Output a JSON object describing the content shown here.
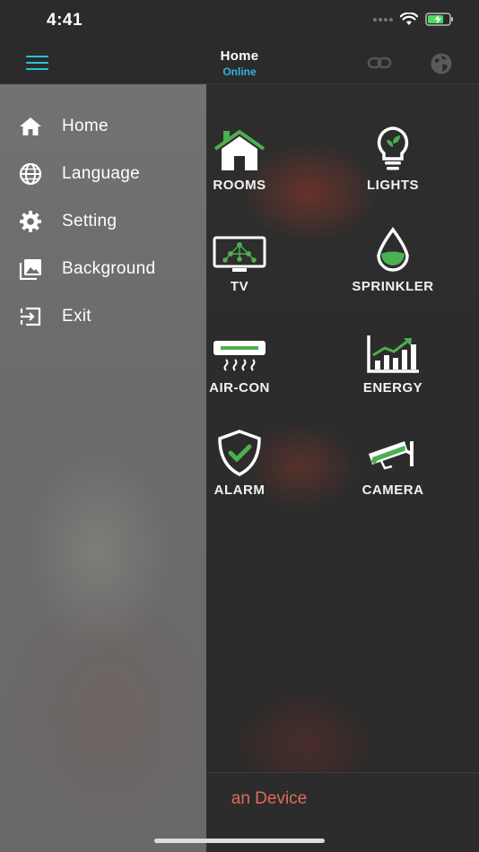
{
  "status_bar": {
    "time": "4:41"
  },
  "header": {
    "title": "Home",
    "subtitle": "Online"
  },
  "grid": [
    {
      "label": "ROOMS",
      "icon": "house-icon"
    },
    {
      "label": "LIGHTS",
      "icon": "lightbulb-icon"
    },
    {
      "label": "TV",
      "icon": "tv-icon"
    },
    {
      "label": "SPRINKLER",
      "icon": "water-drop-icon"
    },
    {
      "label": "AIR-CON",
      "icon": "air-conditioner-icon"
    },
    {
      "label": "ENERGY",
      "icon": "energy-chart-icon"
    },
    {
      "label": "ALARM",
      "icon": "shield-check-icon"
    },
    {
      "label": "CAMERA",
      "icon": "security-camera-icon"
    }
  ],
  "drawer": {
    "items": [
      {
        "label": "Home",
        "icon": "home-icon"
      },
      {
        "label": "Language",
        "icon": "globe-icon"
      },
      {
        "label": "Setting",
        "icon": "gear-icon"
      },
      {
        "label": "Background",
        "icon": "image-icon"
      },
      {
        "label": "Exit",
        "icon": "exit-icon"
      }
    ]
  },
  "bottom": {
    "label": "an Device"
  },
  "colors": {
    "accent": "#24c6d6",
    "icon_green": "#4caf50",
    "online": "#2fb7dd",
    "bottom_text": "#e26a5a"
  }
}
